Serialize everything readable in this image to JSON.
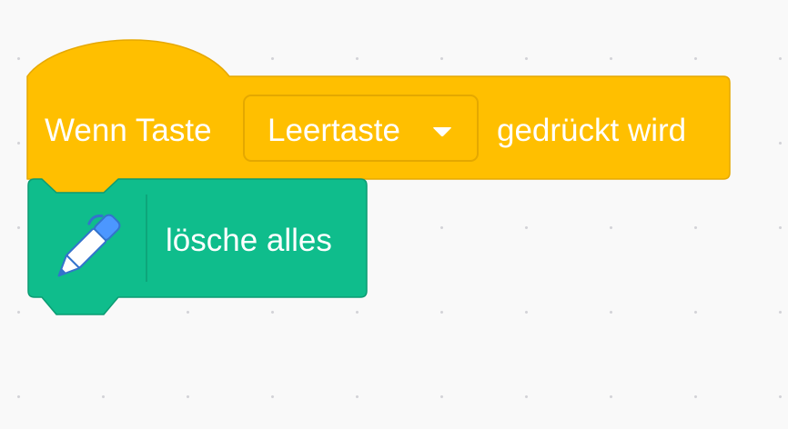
{
  "hat_block": {
    "label": "Wenn Taste",
    "key_value": "Leertaste",
    "suffix": "gedrückt wird",
    "color": "#ffbf00",
    "border_color": "#e6a800"
  },
  "pen_block": {
    "label": "lösche alles",
    "icon": "pen-icon",
    "color": "#0fbd8c",
    "border_color": "#0b9c73"
  },
  "workspace": {
    "background": "#f9f9f9",
    "grid_dot_color": "#d3d3d8"
  }
}
